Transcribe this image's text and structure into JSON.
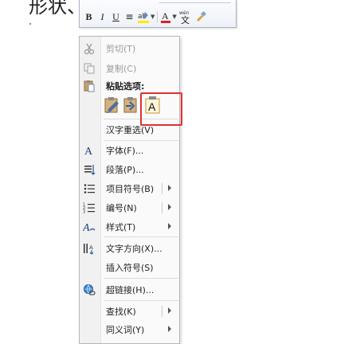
{
  "document": {
    "visible_text": "形状、"
  },
  "mini_toolbar": {
    "bold": "B",
    "italic": "I",
    "underline": "U",
    "center_icon": "≡",
    "font_color_glyph": "A",
    "phonetic_glyph": "wén",
    "phonetic_char": "文"
  },
  "context_menu": {
    "items": [
      {
        "label": "剪切(T)",
        "icon": "scissors-icon",
        "enabled": false
      },
      {
        "label": "复制(C)",
        "icon": "copy-icon",
        "enabled": false
      },
      {
        "label": "粘贴选项:",
        "icon": "paste-icon",
        "enabled": true
      },
      {
        "label": "汉字重选(V)",
        "icon": "",
        "enabled": true
      },
      {
        "label": "字体(F)...",
        "icon": "font-icon",
        "enabled": true
      },
      {
        "label": "段落(P)...",
        "icon": "paragraph-icon",
        "enabled": true
      },
      {
        "label": "项目符号(B)",
        "icon": "bullets-icon",
        "enabled": true,
        "split": true,
        "submenu": true
      },
      {
        "label": "编号(N)",
        "icon": "numbering-icon",
        "enabled": true,
        "split": true,
        "submenu": true
      },
      {
        "label": "样式(T)",
        "icon": "styles-icon",
        "enabled": true,
        "submenu": true
      },
      {
        "label": "文字方向(X)...",
        "icon": "text-direction-icon",
        "enabled": true
      },
      {
        "label": "插入符号(S)",
        "icon": "",
        "enabled": true
      },
      {
        "label": "超链接(H)...",
        "icon": "hyperlink-icon",
        "enabled": true
      },
      {
        "label": "查找(K)",
        "icon": "",
        "enabled": true,
        "split": true,
        "submenu": true
      },
      {
        "label": "同义词(Y)",
        "icon": "",
        "enabled": true,
        "submenu": true
      }
    ],
    "paste_options": [
      {
        "name": "keep-source-formatting",
        "icon": "paste-keep-format-icon"
      },
      {
        "name": "merge-formatting",
        "icon": "paste-merge-format-icon"
      },
      {
        "name": "keep-text-only",
        "icon": "paste-text-only-icon",
        "glyph": "A"
      }
    ]
  },
  "colors": {
    "highlight_border": "#e03030",
    "menu_bg": "#fafafa",
    "gutter_bg": "#f1f1f1"
  }
}
